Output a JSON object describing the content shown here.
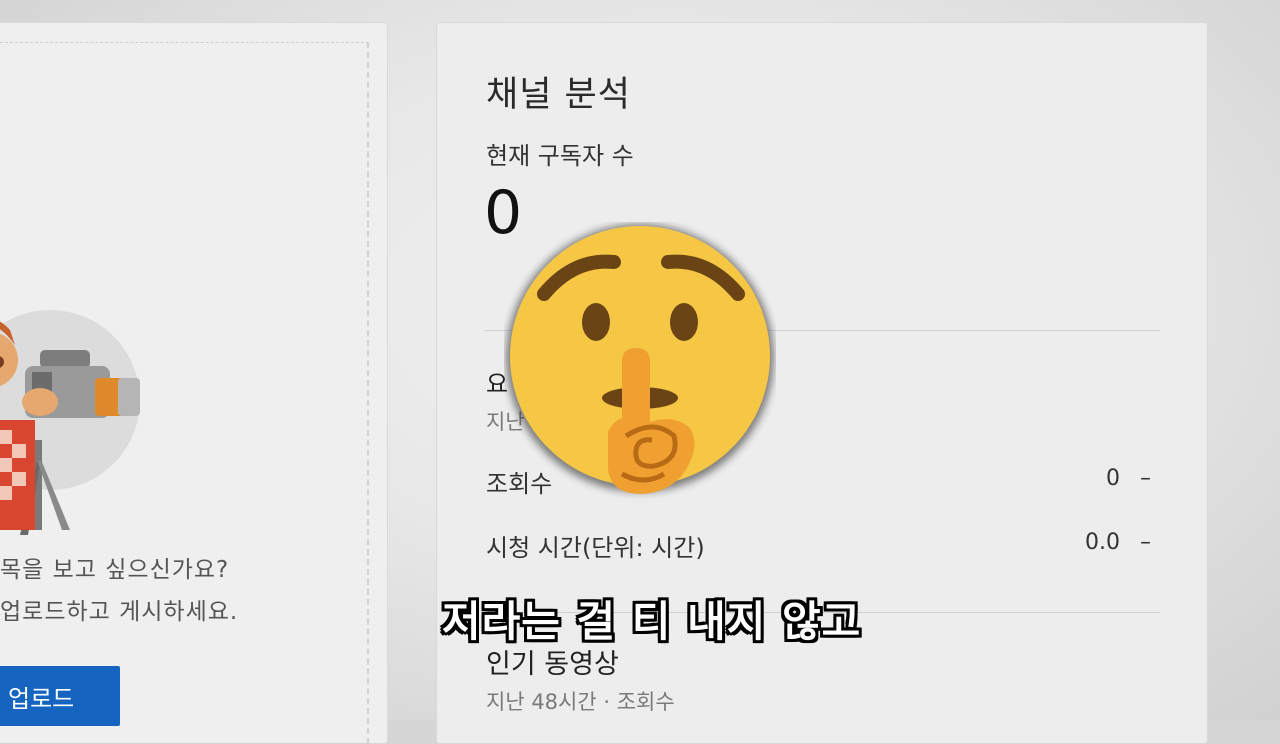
{
  "left_panel": {
    "prompt_line1": "목을 보고 싶으신가요?",
    "prompt_line2": "업로드하고 게시하세요.",
    "upload_button": "업로드"
  },
  "analytics": {
    "title": "채널 분석",
    "subscribers_label": "현재 구독자 수",
    "subscribers_value": "0",
    "summary_title": "요",
    "summary_subtitle": "지난",
    "rows": [
      {
        "label": "조회수",
        "value": "0",
        "trend": "–"
      },
      {
        "label": "시청 시간(단위: 시간)",
        "value": "0.0",
        "trend": "–"
      }
    ],
    "popular_title": "인기 동영상",
    "popular_subtitle": "지난 48시간 · 조회수"
  },
  "overlay": {
    "emoji": "shushing-face",
    "caption": "저라는 걸 티 내지 않고"
  },
  "colors": {
    "upload_button": "#1565c0",
    "emoji_face": "#f6c744",
    "emoji_finger": "#f0a030"
  }
}
